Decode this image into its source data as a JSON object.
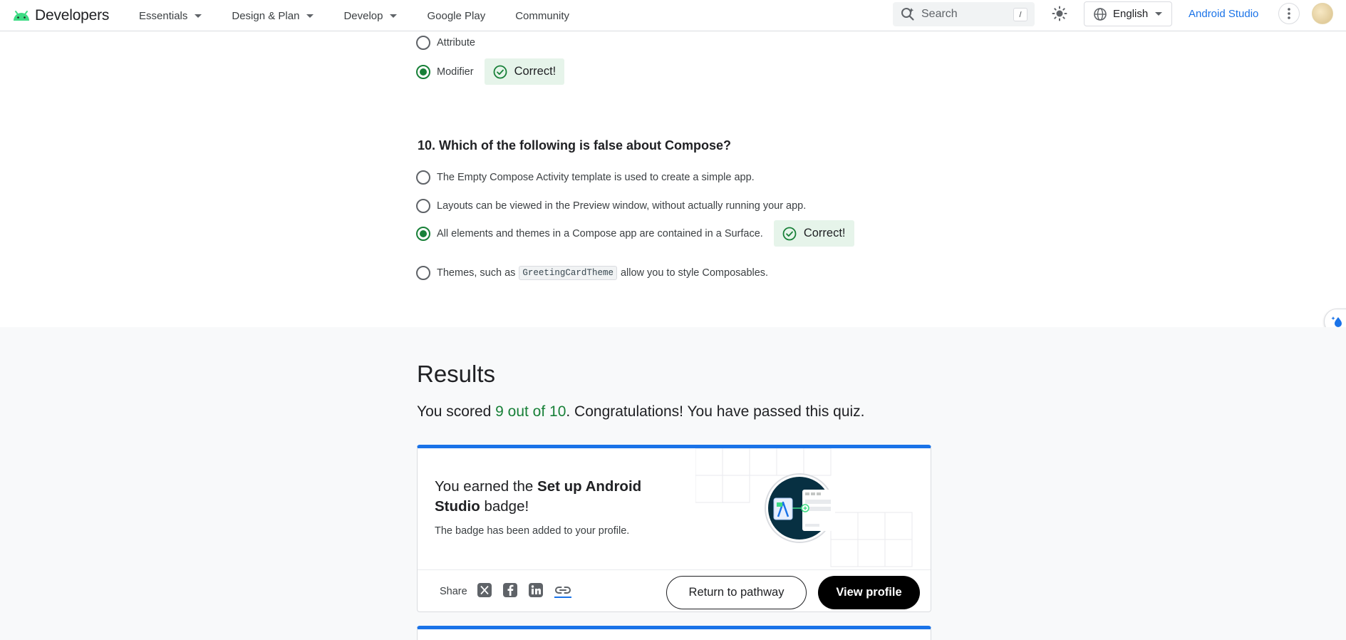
{
  "header": {
    "logo_text": "Developers",
    "nav": [
      {
        "label": "Essentials",
        "dropdown": true
      },
      {
        "label": "Design & Plan",
        "dropdown": true
      },
      {
        "label": "Develop",
        "dropdown": true
      },
      {
        "label": "Google Play",
        "dropdown": false
      },
      {
        "label": "Community",
        "dropdown": false
      }
    ],
    "search_placeholder": "Search",
    "search_shortcut": "/",
    "language": "English",
    "studio_link": "Android Studio"
  },
  "quiz": {
    "prev_question_options": [
      {
        "label": "Attribute",
        "selected": false
      },
      {
        "label": "Modifier",
        "selected": true,
        "feedback": "Correct!"
      }
    ],
    "question": {
      "number": "10.",
      "text": "Which of the following is false about Compose?",
      "options": [
        {
          "label": "The Empty Compose Activity template is used to create a simple app.",
          "selected": false
        },
        {
          "label": "Layouts can be viewed in the Preview window, without actually running your app.",
          "selected": false
        },
        {
          "label": "All elements and themes in a Compose app are contained in a Surface.",
          "selected": true,
          "feedback": "Correct!"
        },
        {
          "label_before": "Themes, such as",
          "code": "GreetingCardTheme",
          "label_after": "allow you to style Composables.",
          "selected": false
        }
      ]
    }
  },
  "results": {
    "title": "Results",
    "score_prefix": "You scored ",
    "score_value": "9 out of 10",
    "score_suffix": ". Congratulations! You have passed this quiz.",
    "badge_card": {
      "earned_prefix": "You earned the ",
      "badge_name": "Set up Android Studio",
      "earned_suffix": " badge!",
      "added_text": "The badge has been added to your profile.",
      "share_label": "Share",
      "share_icons": [
        "x-icon",
        "facebook-icon",
        "linkedin-icon",
        "link-icon"
      ],
      "return_button": "Return to pathway",
      "profile_button": "View profile"
    }
  },
  "colors": {
    "accent": "#1a73e8",
    "success": "#188038",
    "success_bg": "#e6f4ea",
    "results_bg": "#f8f9fa"
  }
}
